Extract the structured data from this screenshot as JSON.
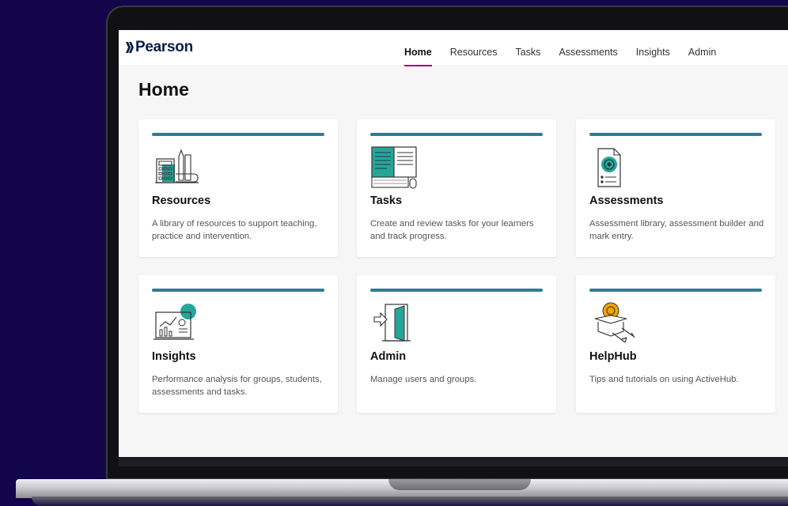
{
  "brand": {
    "logo_text": "Pearson",
    "accent": "#9e007e",
    "card_bar": "#2e7b93",
    "icon_teal": "#26a69a"
  },
  "nav": {
    "items": [
      {
        "label": "Home",
        "active": true
      },
      {
        "label": "Resources"
      },
      {
        "label": "Tasks"
      },
      {
        "label": "Assessments"
      },
      {
        "label": "Insights"
      },
      {
        "label": "Admin"
      }
    ]
  },
  "page": {
    "title": "Home"
  },
  "cards": [
    {
      "title": "Resources",
      "description": "A library of resources to support teaching, practice and intervention.",
      "icon": "calculator-stationery-icon"
    },
    {
      "title": "Tasks",
      "description": "Create and review tasks for your learners and track progress.",
      "icon": "book-keyboard-icon"
    },
    {
      "title": "Assessments",
      "description": "Assessment library, assessment builder and mark entry.",
      "icon": "assessment-document-icon"
    },
    {
      "title": "Insights",
      "description": "Performance analysis for groups, students, assessments and tasks.",
      "icon": "analytics-dashboard-icon"
    },
    {
      "title": "Admin",
      "description": "Manage users and groups.",
      "icon": "door-arrow-icon"
    },
    {
      "title": "HelpHub",
      "description": "Tips and tutorials on using ActiveHub.",
      "icon": "help-box-tools-icon"
    }
  ]
}
